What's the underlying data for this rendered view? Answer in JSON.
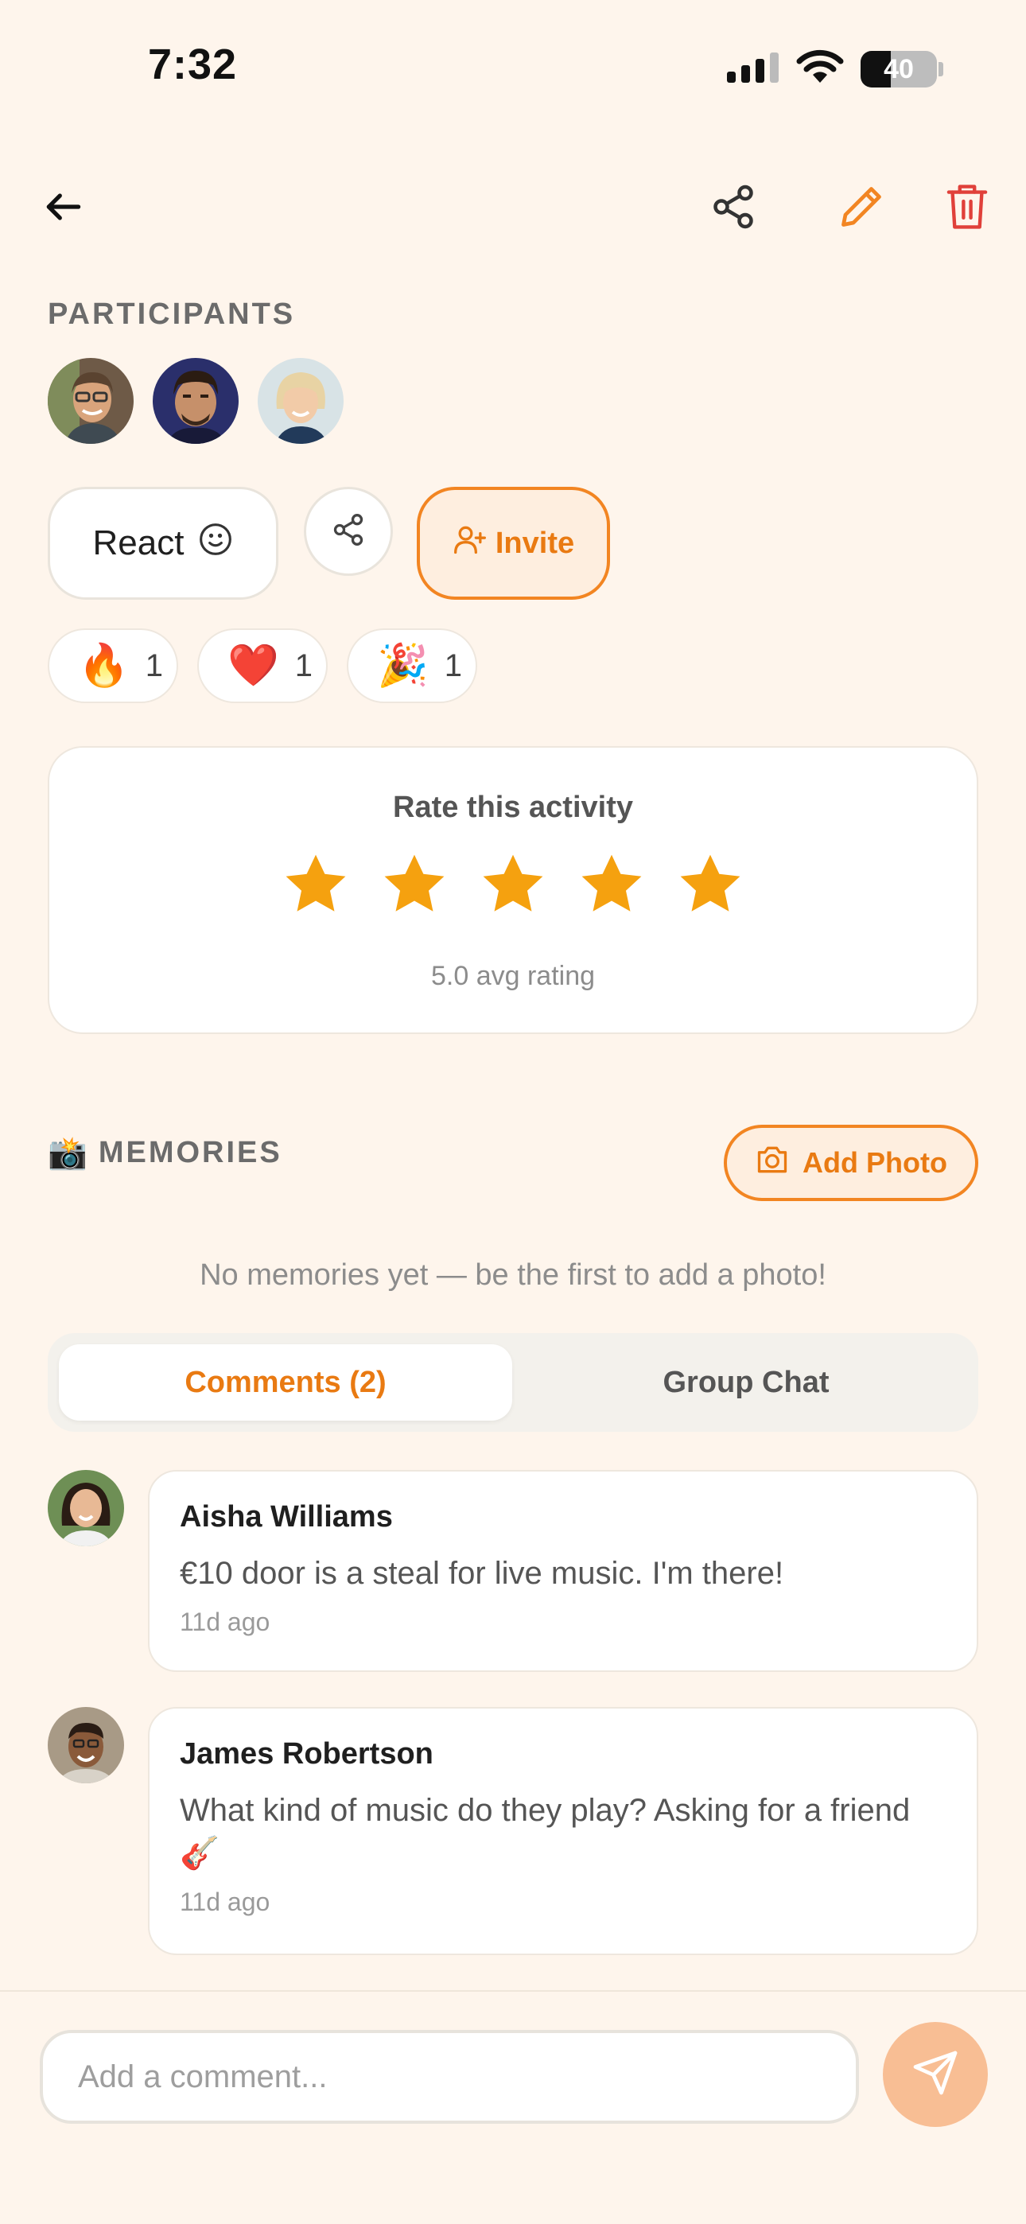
{
  "status_bar": {
    "time": "7:32",
    "battery": "40",
    "battery_level": 0.4
  },
  "nav": {
    "back_icon": "arrow-left-icon",
    "share_icon": "share-icon",
    "edit_icon": "pencil-icon",
    "delete_icon": "trash-icon"
  },
  "participants": {
    "label": "PARTICIPANTS",
    "count": 3
  },
  "actions": {
    "react_label": "React",
    "invite_label": "Invite"
  },
  "reactions": [
    {
      "emoji": "🔥",
      "count": "1"
    },
    {
      "emoji": "❤️",
      "count": "1"
    },
    {
      "emoji": "🎉",
      "count": "1"
    }
  ],
  "rating": {
    "title": "Rate this activity",
    "stars": 5,
    "avg_text": "5.0 avg rating"
  },
  "memories": {
    "emoji": "📸",
    "label": "MEMORIES",
    "add_photo_label": "Add Photo",
    "empty_text": "No memories yet — be the first to add a photo!"
  },
  "tabs": {
    "comments": "Comments (2)",
    "group_chat": "Group Chat"
  },
  "comments": [
    {
      "author": "Aisha Williams",
      "text": "€10 door is a steal for live music. I'm there!",
      "time": "11d ago"
    },
    {
      "author": "James Robertson",
      "text": "What kind of music do they play? Asking for a friend 🎸",
      "time": "11d ago"
    }
  ],
  "composer": {
    "placeholder": "Add a comment..."
  },
  "colors": {
    "background": "#FEF5EC",
    "accent": "#F28522",
    "star": "#F5A10F",
    "delete": "#E0403A",
    "send_button": "#F8BE94"
  }
}
